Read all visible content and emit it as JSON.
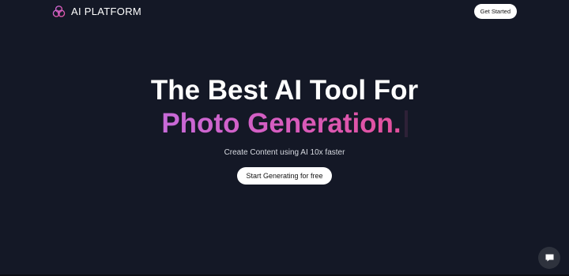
{
  "navbar": {
    "brand_name": "AI PLATFORM",
    "cta_label": "Get Started"
  },
  "hero": {
    "title": "The Best AI Tool For",
    "typed_text": "Photo Generation.",
    "subtitle": "Create Content using AI 10x faster",
    "cta_label": "Start Generating for free"
  },
  "icons": {
    "brand_logo": "three-circles-logo-icon",
    "chat_launcher": "chat-bubble-icon"
  },
  "colors": {
    "background": "#141826",
    "brand_accent": "#c86ad9",
    "gradient_end": "#e3509c",
    "button_bg": "#ffffff",
    "text_primary": "#ffffff"
  }
}
